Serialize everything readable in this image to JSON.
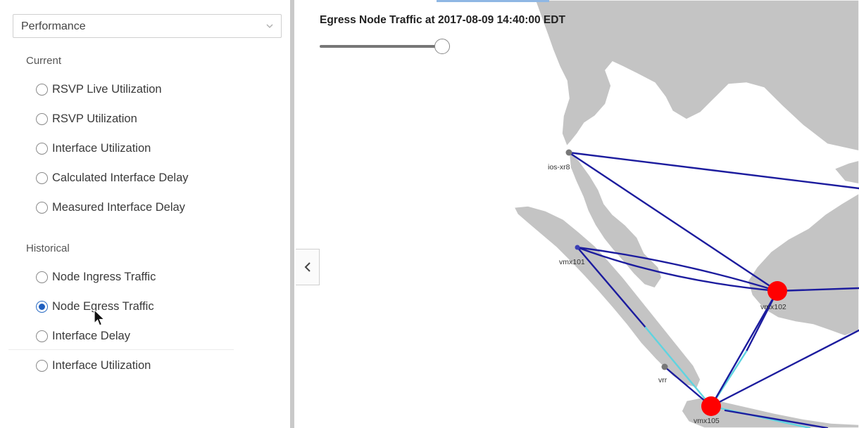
{
  "sidebar": {
    "dropdown": {
      "value": "Performance"
    },
    "current": {
      "label": "Current",
      "options": [
        {
          "label": "RSVP Live Utilization",
          "checked": false
        },
        {
          "label": "RSVP Utilization",
          "checked": false
        },
        {
          "label": "Interface Utilization",
          "checked": false
        },
        {
          "label": "Calculated Interface Delay",
          "checked": false
        },
        {
          "label": "Measured Interface Delay",
          "checked": false
        }
      ]
    },
    "historical": {
      "label": "Historical",
      "options": [
        {
          "label": "Node Ingress Traffic",
          "checked": false
        },
        {
          "label": "Node Egress Traffic",
          "checked": true
        },
        {
          "label": "Interface Delay",
          "checked": false
        },
        {
          "label": "Interface Utilization",
          "checked": false
        }
      ]
    }
  },
  "map": {
    "title": "Egress Node Traffic at 2017-08-09 14:40:00 EDT",
    "slider_level": 1.0,
    "nodes": [
      {
        "name": "ios-xr8",
        "status": "normal",
        "color": "#777777"
      },
      {
        "name": "vmx101",
        "status": "normal",
        "color": "#3b3fb5"
      },
      {
        "name": "vmx102",
        "status": "high",
        "color": "#ff0000"
      },
      {
        "name": "vmx105",
        "status": "high",
        "color": "#ff0000"
      },
      {
        "name": "vrr",
        "status": "normal",
        "color": "#777777"
      }
    ],
    "link_colors": {
      "normal": "#1c1c9e",
      "highlight": "#5fd4e0"
    },
    "land_color": "#c4c4c4"
  },
  "icons": {
    "dropdown": "chevron-down-icon",
    "collapse": "chevron-left-icon",
    "cursor": "mouse-pointer-icon"
  }
}
